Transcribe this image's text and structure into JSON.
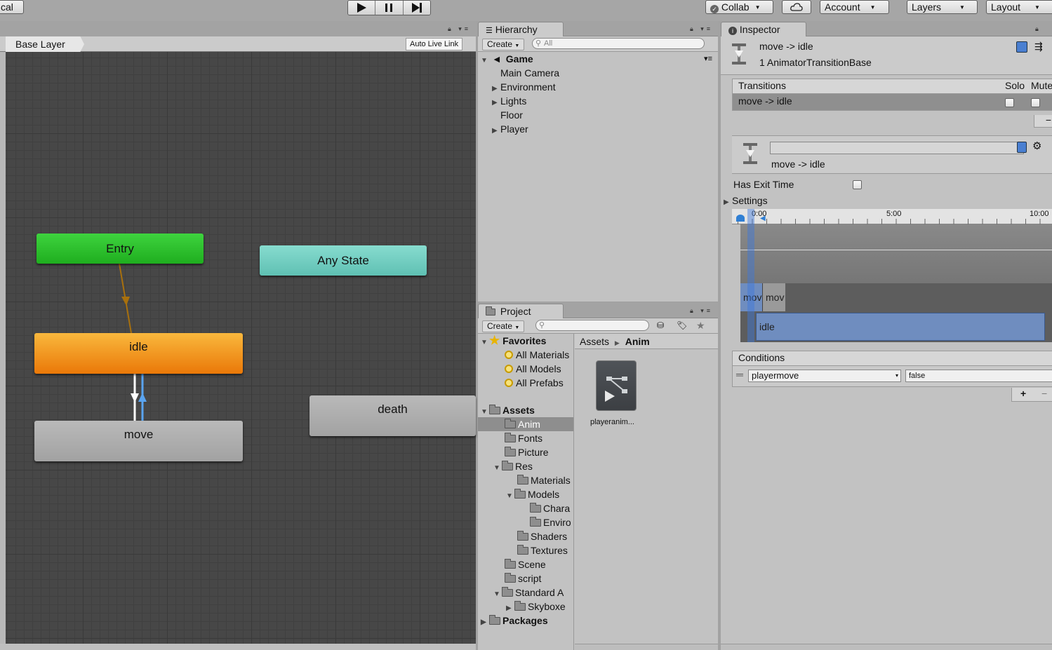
{
  "toolbar": {
    "local_label": "cal",
    "collab_label": "Collab",
    "account_label": "Account",
    "layers_label": "Layers",
    "layout_label": "Layout"
  },
  "animator": {
    "breadcrumb": "Base Layer",
    "auto_live_link": "Auto Live Link",
    "states": {
      "entry": "Entry",
      "any_state": "Any State",
      "idle": "idle",
      "move": "move",
      "death": "death"
    },
    "colors": {
      "entry": "#2cc42c",
      "any_state": "#73cfc2",
      "idle": "#f29218",
      "default": "#ababab",
      "graph_bg": "#474747"
    }
  },
  "hierarchy": {
    "tab": "Hierarchy",
    "create": "Create",
    "search_placeholder": "All",
    "scene": "Game",
    "items": [
      {
        "label": "Main Camera",
        "expandable": false
      },
      {
        "label": "Environment",
        "expandable": true
      },
      {
        "label": "Lights",
        "expandable": true
      },
      {
        "label": "Floor",
        "expandable": false
      },
      {
        "label": "Player",
        "expandable": true
      }
    ]
  },
  "project": {
    "tab": "Project",
    "create": "Create",
    "favorites": {
      "label": "Favorites",
      "items": [
        "All Materials",
        "All Models",
        "All Prefabs"
      ]
    },
    "assets": {
      "label": "Assets",
      "items": [
        {
          "label": "Anim",
          "depth": 1,
          "selected": true
        },
        {
          "label": "Fonts",
          "depth": 1
        },
        {
          "label": "Picture",
          "depth": 1
        },
        {
          "label": "Res",
          "depth": 1,
          "expanded": true
        },
        {
          "label": "Materials",
          "depth": 2
        },
        {
          "label": "Models",
          "depth": 2,
          "expanded": true
        },
        {
          "label": "Chara",
          "depth": 3
        },
        {
          "label": "Enviro",
          "depth": 3
        },
        {
          "label": "Shaders",
          "depth": 2
        },
        {
          "label": "Textures",
          "depth": 2
        },
        {
          "label": "Scene",
          "depth": 1
        },
        {
          "label": "script",
          "depth": 1
        },
        {
          "label": "Standard A",
          "depth": 1,
          "expanded": true
        },
        {
          "label": "Skyboxe",
          "depth": 2,
          "collapsed": true
        }
      ]
    },
    "packages": "Packages",
    "path": {
      "root": "Assets",
      "current": "Anim"
    },
    "file_name": "playeranim..."
  },
  "inspector": {
    "tab": "Inspector",
    "title": "move -> idle",
    "subtitle": "1 AnimatorTransitionBase",
    "transitions_header": "Transitions",
    "solo_label": "Solo",
    "mute_label": "Mute",
    "transition_row": "move -> idle",
    "transition_name": "move -> idle",
    "has_exit_time_label": "Has Exit Time",
    "settings_label": "Settings",
    "timeline": {
      "ticks": [
        "0:00",
        "5:00",
        "10:00"
      ],
      "clip_labels": [
        "mov",
        "mov"
      ],
      "target_clip": "idle"
    },
    "conditions_header": "Conditions",
    "condition": {
      "parameter": "playermove",
      "value": "false"
    },
    "plus": "+",
    "minus": "−"
  }
}
